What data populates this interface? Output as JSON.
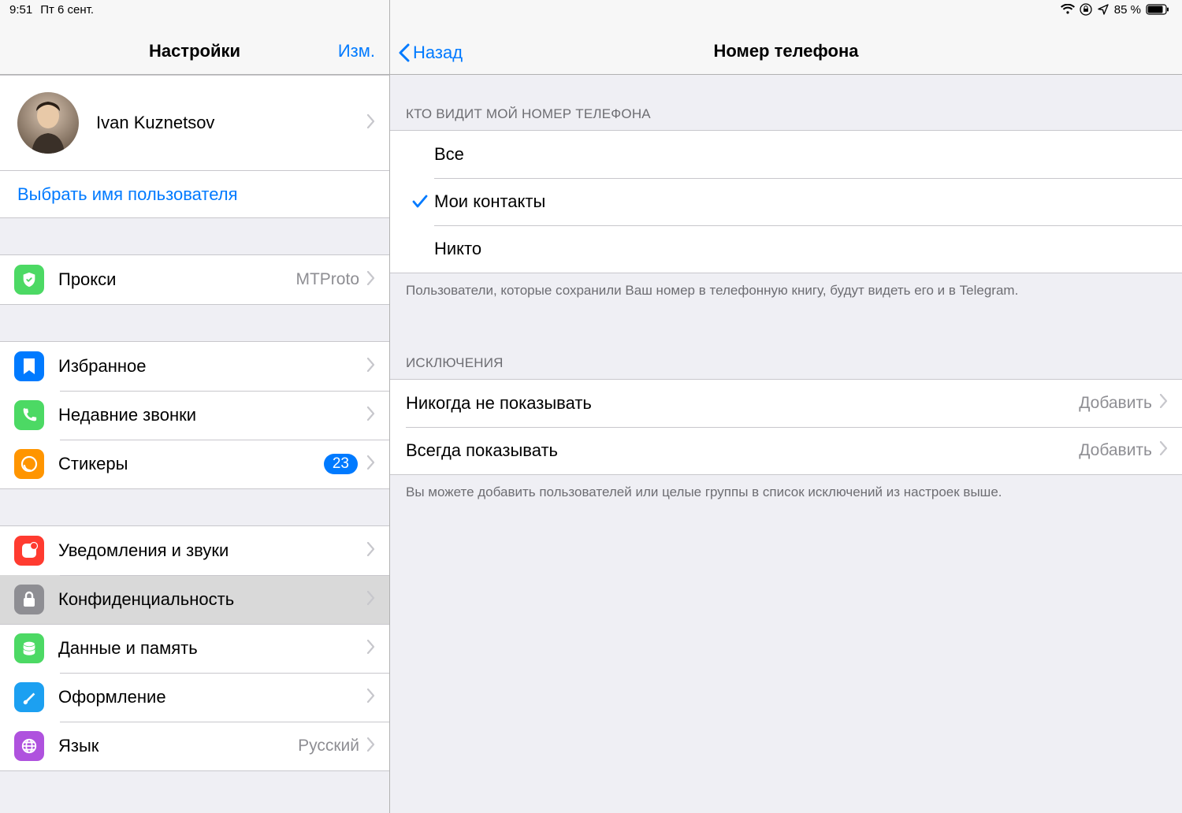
{
  "status": {
    "time": "9:51",
    "date": "Пт 6 сент.",
    "battery_pct": "85 %"
  },
  "sidebar": {
    "title": "Настройки",
    "edit_label": "Изм.",
    "profile_name": "Ivan Kuznetsov",
    "username_prompt": "Выбрать имя пользователя",
    "groups": [
      {
        "items": [
          {
            "icon": "shield",
            "icon_bg": "#4cd964",
            "label": "Прокси",
            "detail": "MTProto"
          }
        ]
      },
      {
        "items": [
          {
            "icon": "bookmark",
            "icon_bg": "#007aff",
            "label": "Избранное"
          },
          {
            "icon": "phone",
            "icon_bg": "#4cd964",
            "label": "Недавние звонки"
          },
          {
            "icon": "sticker",
            "icon_bg": "#ff9500",
            "label": "Стикеры",
            "badge": "23"
          }
        ]
      },
      {
        "items": [
          {
            "icon": "bell-app",
            "icon_bg": "#ff3b30",
            "label": "Уведомления и звуки"
          },
          {
            "icon": "lock",
            "icon_bg": "#8e8e93",
            "label": "Конфиденциальность",
            "selected": true
          },
          {
            "icon": "stack",
            "icon_bg": "#4cd964",
            "label": "Данные и память"
          },
          {
            "icon": "brush",
            "icon_bg": "#1ca0f1",
            "label": "Оформление"
          },
          {
            "icon": "globe",
            "icon_bg": "#af52de",
            "label": "Язык",
            "detail": "Русский"
          }
        ]
      }
    ]
  },
  "detail": {
    "back_label": "Назад",
    "title": "Номер телефона",
    "section1_header": "КТО ВИДИТ МОЙ НОМЕР ТЕЛЕФОНА",
    "options": [
      {
        "label": "Все",
        "checked": false
      },
      {
        "label": "Мои контакты",
        "checked": true
      },
      {
        "label": "Никто",
        "checked": false
      }
    ],
    "section1_footer": "Пользователи, которые сохранили Ваш номер в телефонную книгу, будут видеть его и в Telegram.",
    "section2_header": "ИСКЛЮЧЕНИЯ",
    "exceptions": [
      {
        "label": "Никогда не показывать",
        "detail": "Добавить"
      },
      {
        "label": "Всегда показывать",
        "detail": "Добавить"
      }
    ],
    "section2_footer": "Вы можете добавить пользователей или целые группы в список исключений из настроек выше."
  }
}
